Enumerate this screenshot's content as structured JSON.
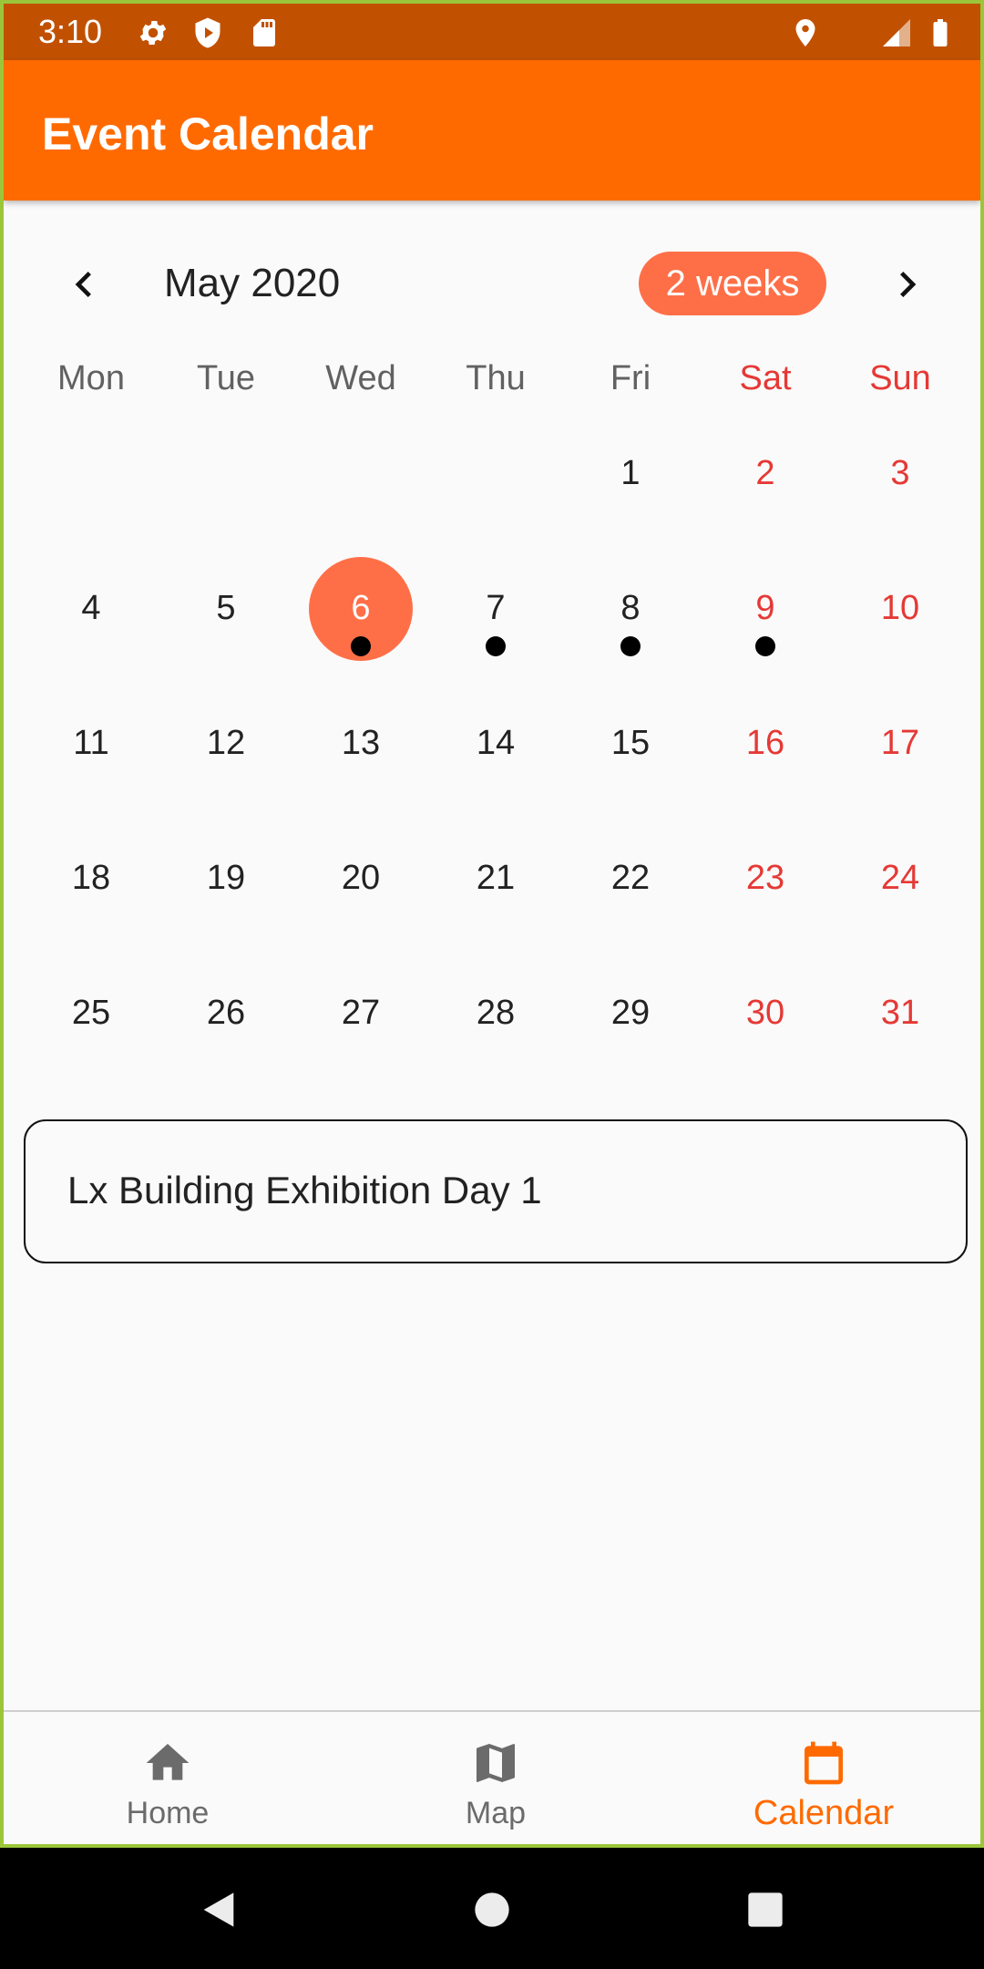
{
  "status_bar": {
    "time": "3:10"
  },
  "app_bar": {
    "title": "Event Calendar"
  },
  "calendar": {
    "month_label": "May 2020",
    "format_button": "2 weeks",
    "weekdays": [
      "Mon",
      "Tue",
      "Wed",
      "Thu",
      "Fri",
      "Sat",
      "Sun"
    ],
    "weeks": [
      [
        "",
        "",
        "",
        "",
        "1",
        "2",
        "3"
      ],
      [
        "4",
        "5",
        "6",
        "7",
        "8",
        "9",
        "10"
      ],
      [
        "11",
        "12",
        "13",
        "14",
        "15",
        "16",
        "17"
      ],
      [
        "18",
        "19",
        "20",
        "21",
        "22",
        "23",
        "24"
      ],
      [
        "25",
        "26",
        "27",
        "28",
        "29",
        "30",
        "31"
      ]
    ],
    "selected_day": "6",
    "days_with_events": [
      "6",
      "7",
      "8",
      "9"
    ]
  },
  "event_card": {
    "title": "Lx Building Exhibition Day 1"
  },
  "bottom_nav": {
    "items": [
      {
        "label": "Home",
        "icon": "home-icon"
      },
      {
        "label": "Map",
        "icon": "map-icon"
      },
      {
        "label": "Calendar",
        "icon": "calendar-icon"
      }
    ],
    "active": "Calendar"
  },
  "colors": {
    "app_bar": "#ff6a00",
    "status_bar": "#c15100",
    "selected_day": "#ff6f47",
    "weekend_text": "#e53935"
  }
}
